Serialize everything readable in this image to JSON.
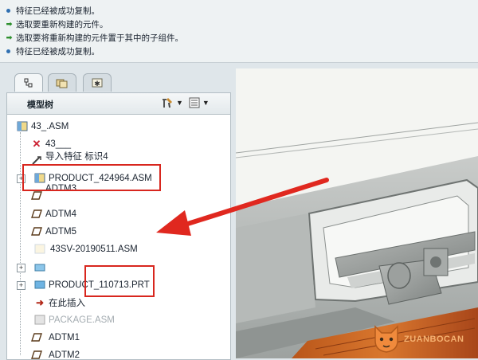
{
  "messages": [
    {
      "kind": "info",
      "text": "特征已经被成功复制。"
    },
    {
      "kind": "prompt",
      "text": "选取要重新构建的元件。"
    },
    {
      "kind": "prompt",
      "text": "选取要将重新构建的元件置于其中的子组件。"
    },
    {
      "kind": "info",
      "text": "特征已经被成功复制。"
    }
  ],
  "panel": {
    "tabs": [
      "model-tree-tab",
      "folder-browser-tab",
      "favorites-tab"
    ],
    "title": "模型树"
  },
  "tree": {
    "root": "43_.ASM",
    "items": [
      {
        "label": "43___",
        "icon": "cross-datum-icon",
        "faded": false
      },
      {
        "label": "导入特征 标识4",
        "icon": "import-feature-icon",
        "faded": false
      },
      {
        "label": "PRODUCT_424964.ASM",
        "icon": "assembly-icon",
        "faded": false
      },
      {
        "label": "ADTM3",
        "icon": "datum-plane-icon",
        "faded": false
      },
      {
        "label": "ADTM4",
        "icon": "datum-plane-icon",
        "faded": false
      },
      {
        "label": "ADTM5",
        "icon": "datum-plane-icon",
        "faded": false
      },
      {
        "label": "43SV-20190511.ASM",
        "icon": "assembly-icon",
        "faded": false
      },
      {
        "label": "",
        "icon": "part-icon",
        "faded": false
      },
      {
        "label": "PRODUCT_110713.PRT",
        "icon": "part-icon",
        "faded": false
      },
      {
        "label": "在此插入",
        "icon": "insert-here-icon",
        "faded": false
      },
      {
        "label": "PACKAGE.ASM",
        "icon": "assembly-icon",
        "faded": true
      },
      {
        "label": "ADTM1",
        "icon": "datum-plane-icon",
        "faded": false
      },
      {
        "label": "ADTM2",
        "icon": "datum-plane-icon",
        "faded": false
      }
    ]
  },
  "watermark": "ZUANBOCAN"
}
